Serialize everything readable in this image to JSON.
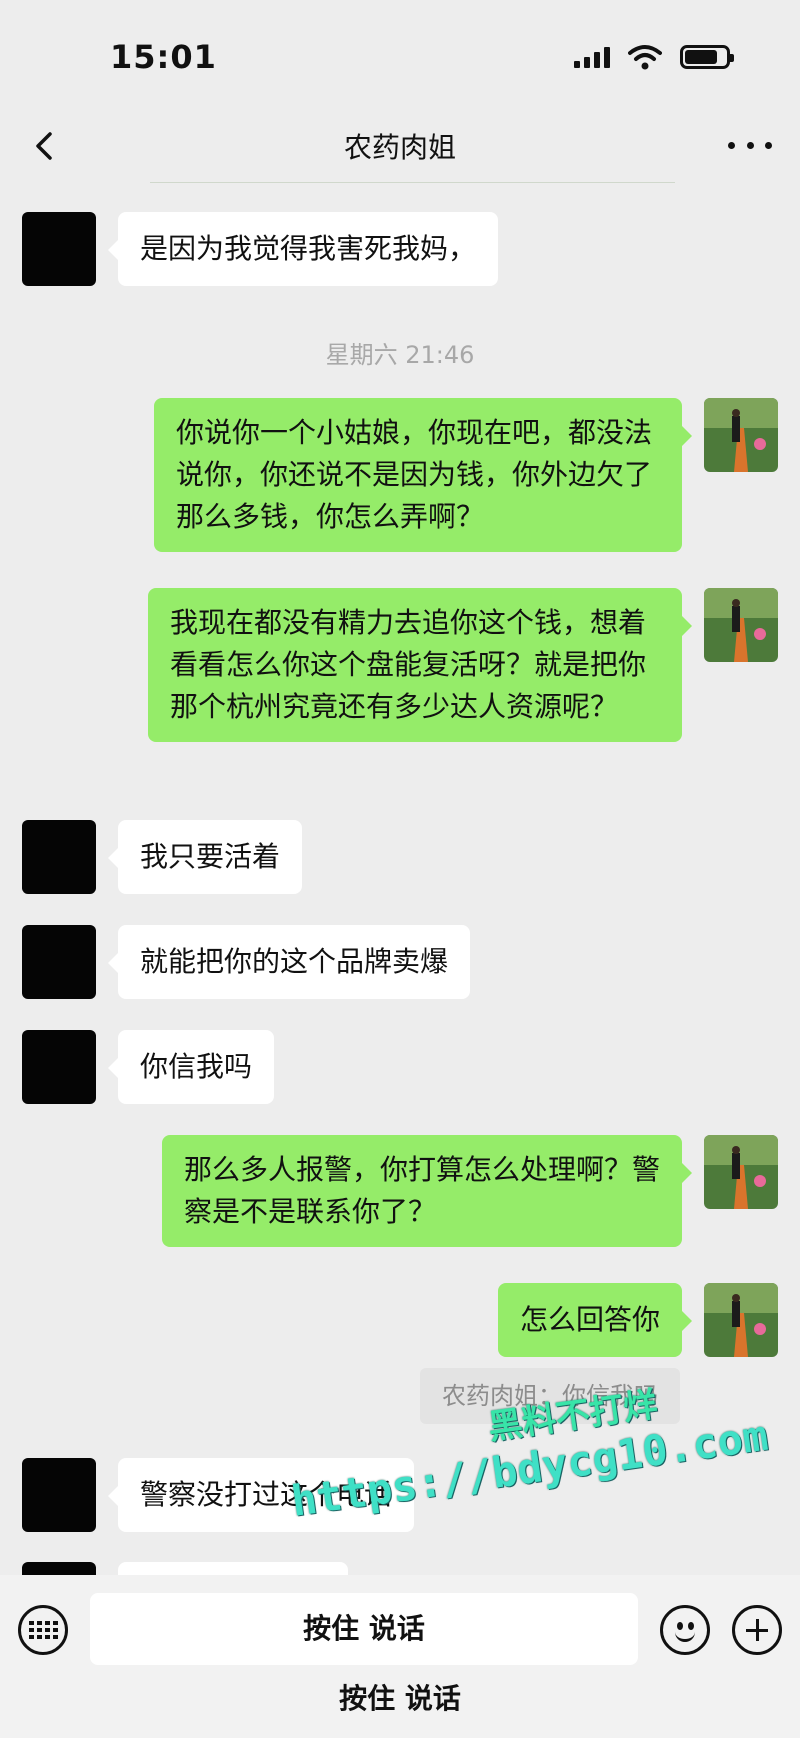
{
  "status_bar": {
    "time": "15:01"
  },
  "header": {
    "title": "农药肉姐"
  },
  "messages": [
    {
      "side": "in",
      "text": "是因为我觉得我害死我妈，"
    },
    {
      "side": "out",
      "text": "你说你一个小姑娘，你现在吧，都没法说你，你还说不是因为钱，你外边欠了那么多钱，你怎么弄啊？"
    },
    {
      "side": "out",
      "text": "我现在都没有精力去追你这个钱，想着看看怎么你这个盘能复活呀？就是把你那个杭州究竟还有多少达人资源呢？"
    },
    {
      "side": "in",
      "text": "我只要活着"
    },
    {
      "side": "in",
      "text": "就能把你的这个品牌卖爆"
    },
    {
      "side": "in",
      "text": "你信我吗"
    },
    {
      "side": "out",
      "text": "那么多人报警，你打算怎么处理啊？警察是不是联系你了？"
    },
    {
      "side": "out",
      "text": "怎么回答你"
    },
    {
      "side": "in",
      "text": "警察没打过这个电话"
    }
  ],
  "timestamp": "星期六 21:46",
  "quote": "农药肉姐：你信我吗",
  "watermark": {
    "line1": "黑料不打烊",
    "line2": "https://bdycg10.com"
  },
  "input_bar": {
    "hold_to_talk": "按住 说话",
    "hold_to_talk_secondary": "按住 说话"
  },
  "icons": [
    "back-icon",
    "more-icon",
    "keyboard-icon",
    "emoji-icon",
    "plus-icon"
  ]
}
